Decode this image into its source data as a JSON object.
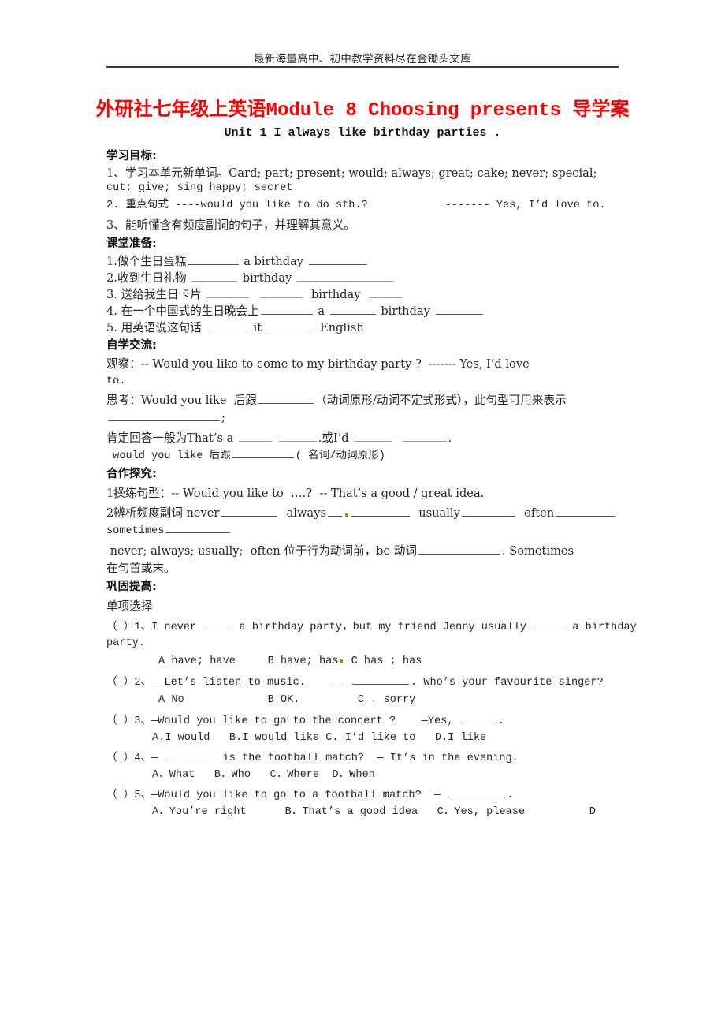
{
  "header": {
    "running_text": "最新海量高中、初中教学资料尽在金锄头文库"
  },
  "title": {
    "main": "外研社七年级上英语Module 8 Choosing presents 导学案",
    "main_color": "#ff0000",
    "unit": "Unit 1 I always like birthday parties ."
  },
  "sections": {
    "objectives_head": "学习目标:",
    "objectives": [
      "1、学习本单元新单词。Card; part; present; would; always; great; cake; never; special;",
      "cut; give; sing happy; secret",
      "2. 重点句式 ----would you like to do sth.?            ------- Yes, I’d love to.",
      "3、能听懂含有频度副词的句子，并理解其意义。"
    ],
    "prep_head": "课堂准备:",
    "prep_items": [
      {
        "cn": "1.做个生日蛋糕",
        "parts": [
          "",
          "a birthday",
          ""
        ]
      },
      {
        "cn": "2.收到生日礼物",
        "parts": [
          "",
          "birthday",
          ""
        ]
      },
      {
        "cn": "3. 送给我生日卡片",
        "parts": [
          "",
          "",
          "birthday",
          ""
        ]
      },
      {
        "cn": "4. 在一个中国式的生日晚会上",
        "parts": [
          "",
          "a",
          "birthday",
          ""
        ]
      },
      {
        "cn": "5. 用英语说这句话",
        "parts": [
          "",
          "it",
          "",
          "English"
        ]
      }
    ],
    "selfstudy_head": "自学交流:",
    "observe_line": "观察：-- Would you like to come to my birthday party ?  ------- Yes, I’d love",
    "observe_line2": "to.",
    "think_line_a": "思考：Would you like  后跟",
    "think_line_a_tail": "（动词原形/动词不定式形式），此句型可用来表示",
    "think_line_b_tail": ";",
    "affirm_a": "肯定回答一般为That’s a ",
    "affirm_b": ".或I’d ",
    "affirm_c": ".",
    "wyl_line_a": " would you like 后跟",
    "wyl_line_b": "( 名词/动词原形)",
    "explore_head": "合作探究:",
    "explore_1": "1操练句型：-- Would you like to  ….?  -- That’s a good / great idea.",
    "explore_2_prefix": "2辨析频度副词 never",
    "explore_2_words": [
      "always",
      "usually",
      "often"
    ],
    "explore_2_last": "sometimes",
    "adverb_rule_a": " never; always; usually;  often 位于行为动词前，be 动词",
    "adverb_rule_b": ". Sometimes",
    "adverb_rule_c": "在句首或末。",
    "consolidate_head": "巩固提高:",
    "consolidate_sub": "单项选择"
  },
  "questions": [
    {
      "marker": "（ ）1、",
      "stem_a": "I never ",
      "stem_b": " a birthday party，but my friend Jenny usually ",
      "stem_c": " a birthday",
      "stem_wrap": "party.",
      "options": "A have; have     B have; has",
      "options_tail": "C has ; has"
    },
    {
      "marker": "（ ）2、",
      "stem_a": "——Let’s listen to music.    —— ",
      "stem_b": ". Who’s your favourite singer?",
      "options": "A No             B OK.         C . sorry"
    },
    {
      "marker": "（ ）3、",
      "stem_a": "—Would you like to go to the concert ?    —Yes, ",
      "stem_b": ".",
      "options": "A.I would   B.I would like C. I’d like to   D.I like"
    },
    {
      "marker": "（ ）4、",
      "stem_a": "— ",
      "stem_b": " is the football match?  — It’s in the evening.",
      "options": "A．What   B．Who   C．Where  D．When"
    },
    {
      "marker": "（ ）5、",
      "stem_a": "—Would you like to go to a football match?  — ",
      "stem_b": ".",
      "options": "A．You’re right      B．That’s a good idea   C．Yes, please          D"
    }
  ]
}
